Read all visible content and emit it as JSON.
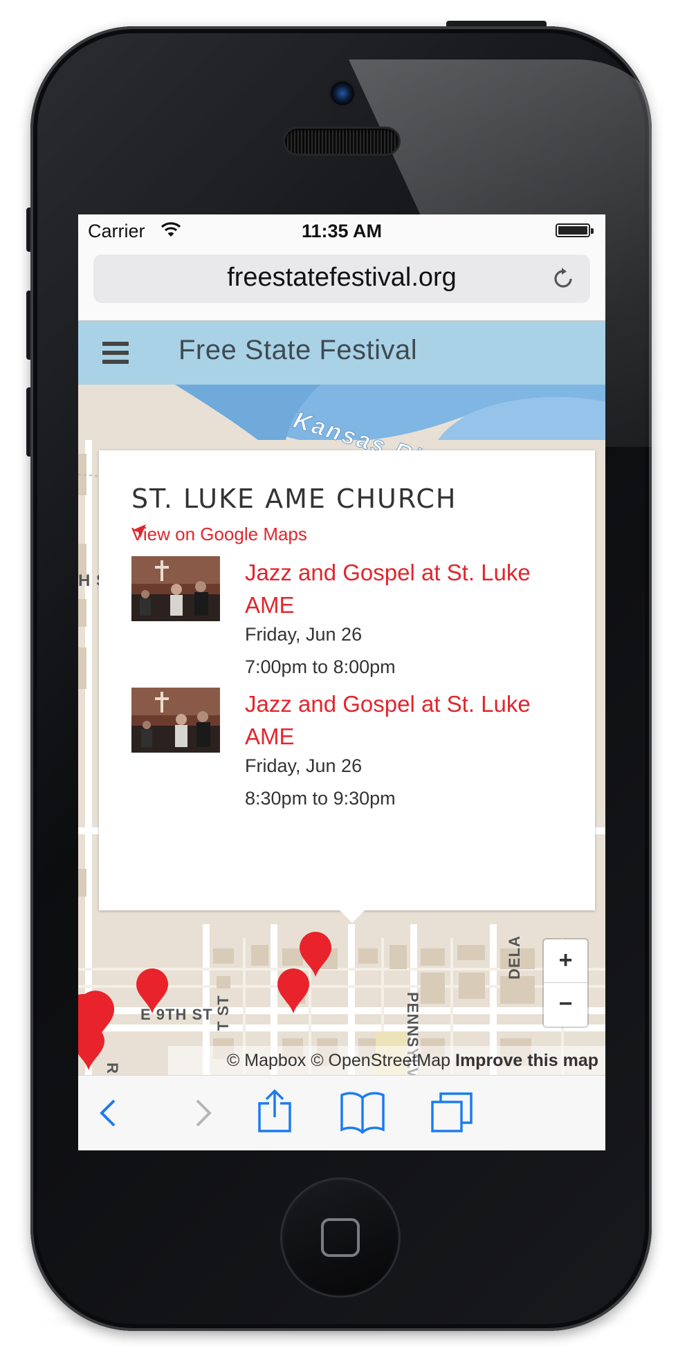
{
  "status_bar": {
    "carrier": "Carrier",
    "time": "11:35 AM"
  },
  "browser": {
    "url": "freestatefestival.org",
    "reload_icon": "reload-icon"
  },
  "site": {
    "title": "Free State Festival",
    "menu_icon": "hamburger-menu-icon",
    "header_color": "#a9d2e6"
  },
  "map": {
    "river_label": "Kansas River",
    "streets": {
      "e9th": "E 9TH ST",
      "rhode": "RHODE",
      "st": "T ST",
      "pennsylvania": "PENNSYLVA",
      "dela": "DELA",
      "h_s": "H S"
    },
    "zoom_in": "+",
    "zoom_out": "−",
    "attribution": {
      "mapbox": "© Mapbox",
      "osm": "© OpenStreetMap",
      "improve": "Improve this map"
    },
    "marker_color": "#e8232b"
  },
  "popup": {
    "venue": "ST. LUKE AME CHURCH",
    "maps_link": "View on Google Maps",
    "events": [
      {
        "title": "Jazz and Gospel at St. Luke AME",
        "date": "Friday, Jun 26",
        "time": "7:00pm to 8:00pm"
      },
      {
        "title": "Jazz and Gospel at St. Luke AME",
        "date": "Friday, Jun 26",
        "time": "8:30pm to 9:30pm"
      }
    ]
  },
  "toolbar": {
    "back_icon": "back-chevron-icon",
    "forward_icon": "forward-chevron-icon",
    "share_icon": "share-icon",
    "bookmarks_icon": "book-icon",
    "tabs_icon": "tabs-icon",
    "tint": "#1b7cf0"
  },
  "accent": "#e1262d"
}
